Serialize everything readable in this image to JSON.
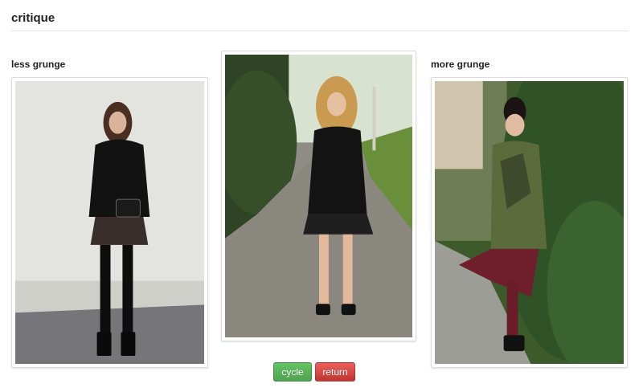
{
  "header": {
    "title": "critique"
  },
  "columns": {
    "left": {
      "label": "less grunge"
    },
    "middle": {
      "label": ""
    },
    "right": {
      "label": "more grunge"
    }
  },
  "buttons": {
    "cycle": "cycle",
    "return": "return"
  },
  "colors": {
    "cycle_button": "#5bb75b",
    "return_button": "#da4f49",
    "rule": "#e6e6e6"
  }
}
